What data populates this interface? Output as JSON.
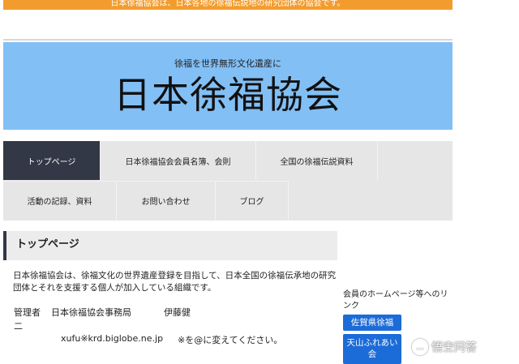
{
  "banner": {
    "text": "日本徐福協会は、日本各地の徐福伝説地の研究団体の協会です。"
  },
  "hero": {
    "subtitle": "徐福を世界無形文化遺産に",
    "title": "日本徐福協会"
  },
  "nav": {
    "items": [
      {
        "label": "トップページ",
        "active": true
      },
      {
        "label": "日本徐福協会会員名簿、会則"
      },
      {
        "label": "全国の徐福伝説資料"
      },
      {
        "label": "活動の記録、資料"
      },
      {
        "label": "お問い合わせ"
      },
      {
        "label": "ブログ"
      }
    ]
  },
  "main": {
    "heading": "トップページ",
    "intro": "日本徐福協会は、徐福文化の世界遺産登録を目指して、日本全国の徐福伝承地の研究団体とそれを支援する個人が加入している組織です。",
    "manager_label": "管理者",
    "manager_org": "日本徐福協会事務局",
    "manager_name_1": "伊藤健",
    "manager_name_2": "二",
    "email": "xufu※krd.biglobe.ne.jp",
    "email_note": "※を@に変えてください。"
  },
  "sidebar": {
    "label": "会員のホームページ等へのリンク",
    "links": [
      {
        "label": "佐賀県徐福"
      },
      {
        "label_line1": "天山ふれあい",
        "label_line2": "会"
      }
    ]
  },
  "watermark": {
    "text": "悟空问答",
    "icon": "chat-bubble-icon"
  },
  "colors": {
    "banner": "#f39c2e",
    "hero": "#82bff5",
    "nav_active": "#333847",
    "link_button": "#1b6bd8"
  }
}
